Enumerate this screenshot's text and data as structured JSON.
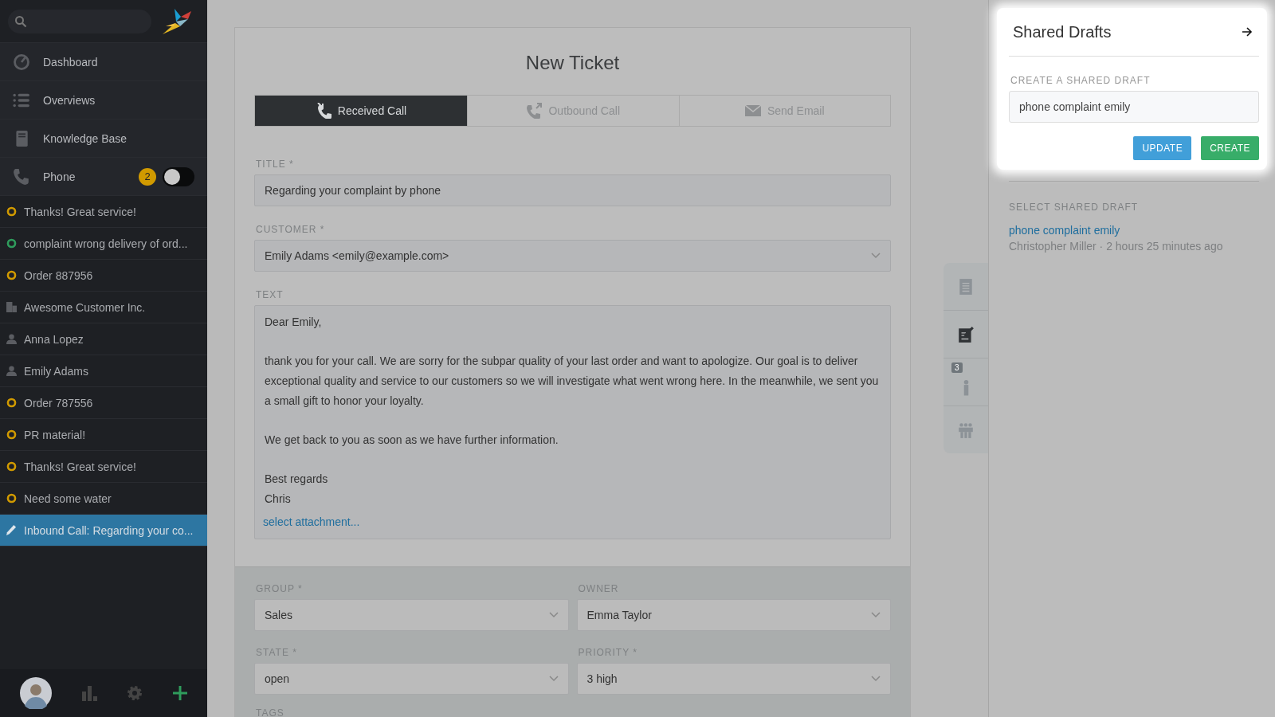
{
  "sidebar": {
    "nav": [
      {
        "kind": "dashboard",
        "label": "Dashboard"
      },
      {
        "kind": "overviews",
        "label": "Overviews"
      },
      {
        "kind": "knowledge",
        "label": "Knowledge Base"
      },
      {
        "kind": "phone",
        "label": "Phone",
        "badge": "2",
        "on": false
      }
    ],
    "items": [
      {
        "kind": "ticket",
        "label": "Thanks! Great service!",
        "color": "#d19a00",
        "selected": false
      },
      {
        "kind": "ticket",
        "label": "complaint wrong delivery of ord...",
        "color": "#2f9c5c",
        "selected": false
      },
      {
        "kind": "ticket",
        "label": "Order 887956",
        "color": "#d19a00",
        "selected": false
      },
      {
        "kind": "organization",
        "label": "Awesome Customer Inc.",
        "selected": false
      },
      {
        "kind": "user",
        "label": "Anna Lopez",
        "selected": false
      },
      {
        "kind": "user",
        "label": "Emily Adams",
        "selected": false
      },
      {
        "kind": "ticket",
        "label": "Order 787556",
        "color": "#d19a00",
        "selected": false
      },
      {
        "kind": "ticket",
        "label": "PR material!",
        "color": "#d19a00",
        "selected": false
      },
      {
        "kind": "ticket",
        "label": "Thanks! Great service!",
        "color": "#d19a00",
        "selected": false
      },
      {
        "kind": "ticket",
        "label": "Need some water",
        "color": "#d19a00",
        "selected": false
      },
      {
        "kind": "draft",
        "label": "Inbound Call: Regarding your co...",
        "selected": true
      }
    ]
  },
  "ticket": {
    "title": "New Ticket",
    "tabs": [
      {
        "kind": "received",
        "label": "Received Call",
        "selected": true
      },
      {
        "kind": "outbound",
        "label": "Outbound Call",
        "selected": false
      },
      {
        "kind": "email",
        "label": "Send Email",
        "selected": false
      }
    ],
    "title_field": {
      "label": "TITLE *",
      "value": "Regarding your complaint by phone"
    },
    "customer_field": {
      "label": "CUSTOMER *",
      "value": "Emily Adams <emily@example.com>"
    },
    "text_field": {
      "label": "TEXT",
      "paragraphs": [
        "Dear Emily,",
        "thank you for your call. We are sorry for the subpar quality of your last order and want to apologize. Our goal is to deliver exceptional quality and service to our customers so we will investigate what went wrong here. In the meanwhile, we sent you a small gift to honor your loyalty.",
        "We get back to you as soon as we have further information.",
        "Best regards\nChris"
      ],
      "attachment_link": "select attachment..."
    },
    "attributes": [
      {
        "label": "GROUP *",
        "value": "Sales"
      },
      {
        "label": "OWNER",
        "value": "Emma Taylor"
      },
      {
        "label": "STATE *",
        "value": "open"
      },
      {
        "label": "PRIORITY *",
        "value": "3 high"
      }
    ],
    "tags_label": "TAGS"
  },
  "side_tabs": [
    {
      "kind": "document",
      "selected": false
    },
    {
      "kind": "edit",
      "selected": true
    },
    {
      "kind": "customer",
      "badge": "3",
      "selected": false
    },
    {
      "kind": "organization",
      "selected": false
    }
  ],
  "shared_drafts": {
    "title": "Shared Drafts",
    "create_label": "CREATE A SHARED DRAFT",
    "name_field": {
      "value": "phone complaint emily"
    },
    "buttons": [
      {
        "kind": "update",
        "label": "UPDATE"
      },
      {
        "kind": "create",
        "label": "CREATE"
      }
    ],
    "select_label": "SELECT SHARED DRAFT",
    "drafts": [
      {
        "name": "phone complaint emily",
        "meta": "Christopher Miller · 2 hours 25 minutes ago"
      }
    ]
  }
}
